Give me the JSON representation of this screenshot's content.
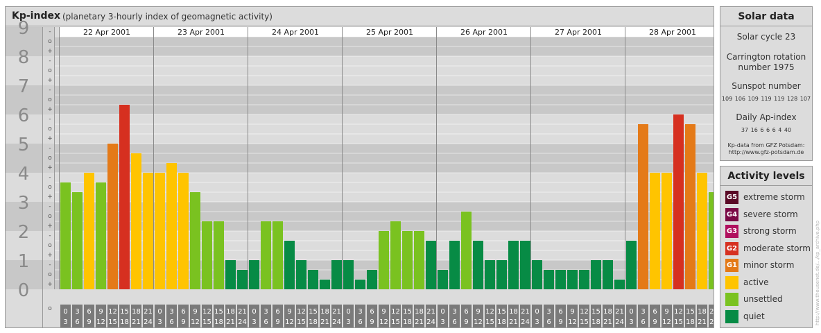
{
  "title": {
    "main": "Kp-index",
    "sub": "(planetary 3-hourly index of geomagnetic activity)"
  },
  "solar": {
    "heading": "Solar data",
    "cycle": "Solar cycle 23",
    "carrington_line1": "Carrington rotation",
    "carrington_line2": "number 1975",
    "sunspot_label": "Sunspot number",
    "sunspot_values": "109 106 109 119 119 128 107",
    "ap_label": "Daily Ap-index",
    "ap_values": "37 16 6 6 6 4 40",
    "source_line1": "Kp-data from GFZ Potsdam:",
    "source_line2": "http://www.gfz-potsdam.de"
  },
  "levels": {
    "heading": "Activity levels",
    "items": [
      {
        "code": "G5",
        "label": "extreme storm",
        "color": "#5a0a26"
      },
      {
        "code": "G4",
        "label": "severe storm",
        "color": "#7a0a45"
      },
      {
        "code": "G3",
        "label": "strong storm",
        "color": "#b0105e"
      },
      {
        "code": "G2",
        "label": "moderate storm",
        "color": "#d63020"
      },
      {
        "code": "G1",
        "label": "minor storm",
        "color": "#e47a18"
      },
      {
        "code": "",
        "label": "active",
        "color": "#ffc400"
      },
      {
        "code": "",
        "label": "unsettled",
        "color": "#7ac220"
      },
      {
        "code": "",
        "label": "quiet",
        "color": "#078b45"
      }
    ]
  },
  "credit": "http://www.theusenet.de/.../kp_archive.php",
  "chart_data": {
    "type": "bar",
    "ylim": [
      0,
      9
    ],
    "y_ticks": [
      "0",
      "1",
      "2",
      "3",
      "4",
      "5",
      "6",
      "7",
      "8",
      "9"
    ],
    "minor_ticks": [
      "+",
      "o",
      "-"
    ],
    "days": [
      "22 Apr 2001",
      "23 Apr 2001",
      "24 Apr 2001",
      "25 Apr 2001",
      "26 Apr 2001",
      "27 Apr 2001",
      "28 Apr 2001"
    ],
    "interval_start": [
      "0",
      "3",
      "6",
      "9",
      "12",
      "15",
      "18",
      "21"
    ],
    "interval_end": [
      "3",
      "6",
      "9",
      "12",
      "15",
      "18",
      "21",
      "24"
    ],
    "values": [
      [
        3.667,
        3.333,
        4.0,
        3.667,
        5.0,
        6.333,
        4.667,
        4.0
      ],
      [
        4.0,
        4.333,
        4.0,
        3.333,
        2.333,
        2.333,
        1.0,
        0.667
      ],
      [
        1.0,
        2.333,
        2.333,
        1.667,
        1.0,
        0.667,
        0.333,
        1.0
      ],
      [
        1.0,
        0.333,
        0.667,
        2.0,
        2.333,
        2.0,
        2.0,
        1.667
      ],
      [
        0.667,
        1.667,
        2.667,
        1.667,
        1.0,
        1.0,
        1.667,
        1.667
      ],
      [
        1.0,
        0.667,
        0.667,
        0.667,
        0.667,
        1.0,
        1.0,
        0.333
      ],
      [
        1.667,
        5.667,
        4.0,
        4.0,
        6.0,
        5.667,
        4.0,
        3.333
      ]
    ],
    "colors": {
      "g2": "#d63020",
      "g1": "#e47a18",
      "active": "#ffc400",
      "unsettled": "#7ac220",
      "quiet": "#078b45"
    }
  }
}
